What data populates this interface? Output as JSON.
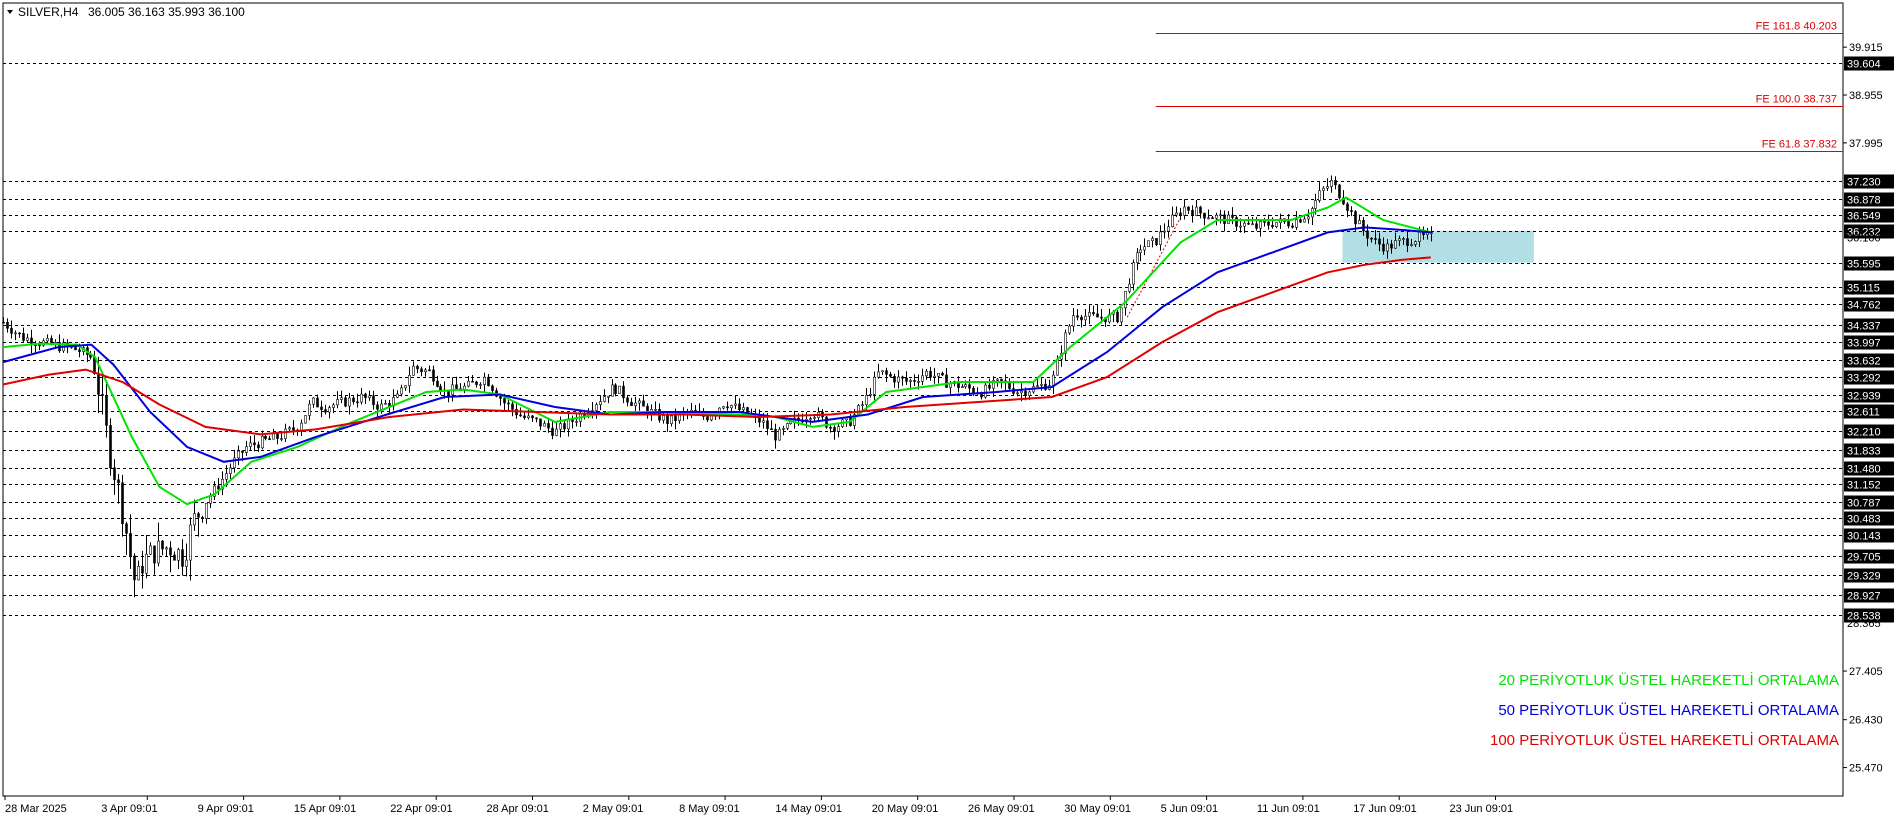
{
  "header": {
    "symbol": "SILVER,H4",
    "ohlc": "36.005 36.163 35.993 36.100"
  },
  "chart_data": {
    "type": "candlestick",
    "y_axis": {
      "range": [
        24.9,
        40.8
      ],
      "ticks": [
        "39.915",
        "38.955",
        "37.995",
        "27.405",
        "26.430",
        "25.470"
      ]
    },
    "x_axis": {
      "ticks": [
        "28 Mar 2025",
        "3 Apr 09:01",
        "9 Apr 09:01",
        "15 Apr 09:01",
        "22 Apr 09:01",
        "28 Apr 09:01",
        "2 May 09:01",
        "8 May 09:01",
        "14 May 09:01",
        "20 May 09:01",
        "26 May 09:01",
        "30 May 09:01",
        "5 Jun 09:01",
        "11 Jun 09:01",
        "17 Jun 09:01",
        "23 Jun 09:01"
      ]
    },
    "levels": [
      "39.604",
      "37.230",
      "36.878",
      "36.549",
      "36.232",
      "35.595",
      "35.115",
      "34.762",
      "34.337",
      "33.997",
      "33.632",
      "33.292",
      "32.939",
      "32.611",
      "32.210",
      "31.833",
      "31.480",
      "31.152",
      "30.787",
      "30.483",
      "30.143",
      "29.705",
      "29.329",
      "28.927",
      "28.538"
    ],
    "hidden_labels": [
      "36.100",
      "28.365"
    ],
    "fibonacci": [
      {
        "label": "FE 161.8 40.203",
        "value": 40.203
      },
      {
        "label": "FE 100.0 38.737",
        "value": 38.737
      },
      {
        "label": "FE 61.8 37.832",
        "value": 37.832
      }
    ],
    "zone": {
      "top": 36.232,
      "bottom": 35.595,
      "from_x": 0.728,
      "to_x": 0.832
    },
    "price_path": [
      [
        0.0,
        34.4
      ],
      [
        0.01,
        34.1
      ],
      [
        0.02,
        34.0
      ],
      [
        0.03,
        33.92
      ],
      [
        0.04,
        33.85
      ],
      [
        0.048,
        33.7
      ],
      [
        0.053,
        32.9
      ],
      [
        0.058,
        31.8
      ],
      [
        0.063,
        31.0
      ],
      [
        0.068,
        30.0
      ],
      [
        0.072,
        29.1
      ],
      [
        0.076,
        29.6
      ],
      [
        0.082,
        29.8
      ],
      [
        0.09,
        29.9
      ],
      [
        0.098,
        29.7
      ],
      [
        0.103,
        30.4
      ],
      [
        0.11,
        30.8
      ],
      [
        0.118,
        31.2
      ],
      [
        0.125,
        31.6
      ],
      [
        0.132,
        31.9
      ],
      [
        0.14,
        32.0
      ],
      [
        0.15,
        32.1
      ],
      [
        0.16,
        32.3
      ],
      [
        0.168,
        32.8
      ],
      [
        0.175,
        32.7
      ],
      [
        0.185,
        32.8
      ],
      [
        0.195,
        32.9
      ],
      [
        0.205,
        32.7
      ],
      [
        0.215,
        32.9
      ],
      [
        0.222,
        33.5
      ],
      [
        0.232,
        33.4
      ],
      [
        0.24,
        33.0
      ],
      [
        0.252,
        33.1
      ],
      [
        0.262,
        33.3
      ],
      [
        0.272,
        32.8
      ],
      [
        0.282,
        32.5
      ],
      [
        0.29,
        32.4
      ],
      [
        0.3,
        32.2
      ],
      [
        0.312,
        32.5
      ],
      [
        0.322,
        32.8
      ],
      [
        0.332,
        33.1
      ],
      [
        0.342,
        32.8
      ],
      [
        0.352,
        32.6
      ],
      [
        0.362,
        32.4
      ],
      [
        0.372,
        32.6
      ],
      [
        0.382,
        32.5
      ],
      [
        0.392,
        32.8
      ],
      [
        0.402,
        32.6
      ],
      [
        0.412,
        32.4
      ],
      [
        0.42,
        32.1
      ],
      [
        0.43,
        32.4
      ],
      [
        0.44,
        32.6
      ],
      [
        0.45,
        32.3
      ],
      [
        0.46,
        32.4
      ],
      [
        0.468,
        32.8
      ],
      [
        0.476,
        33.4
      ],
      [
        0.482,
        33.3
      ],
      [
        0.492,
        33.2
      ],
      [
        0.502,
        33.4
      ],
      [
        0.512,
        33.2
      ],
      [
        0.522,
        33.1
      ],
      [
        0.532,
        33.0
      ],
      [
        0.542,
        33.2
      ],
      [
        0.552,
        33.0
      ],
      [
        0.562,
        33.1
      ],
      [
        0.57,
        33.2
      ],
      [
        0.576,
        34.0
      ],
      [
        0.582,
        34.6
      ],
      [
        0.59,
        34.5
      ],
      [
        0.598,
        34.5
      ],
      [
        0.606,
        34.5
      ],
      [
        0.612,
        35.3
      ],
      [
        0.618,
        35.9
      ],
      [
        0.626,
        36.0
      ],
      [
        0.634,
        36.4
      ],
      [
        0.642,
        36.7
      ],
      [
        0.65,
        36.6
      ],
      [
        0.66,
        36.5
      ],
      [
        0.67,
        36.4
      ],
      [
        0.68,
        36.3
      ],
      [
        0.69,
        36.4
      ],
      [
        0.7,
        36.4
      ],
      [
        0.71,
        36.6
      ],
      [
        0.716,
        37.0
      ],
      [
        0.722,
        37.2
      ],
      [
        0.728,
        36.9
      ],
      [
        0.734,
        36.5
      ],
      [
        0.74,
        36.2
      ],
      [
        0.746,
        36.0
      ],
      [
        0.752,
        35.9
      ],
      [
        0.758,
        36.0
      ],
      [
        0.764,
        36.05
      ],
      [
        0.77,
        36.1
      ],
      [
        0.776,
        36.1
      ]
    ],
    "series": [
      {
        "name": "20 PERİYOTLUK ÜSTEL HAREKETLİ ORTALAMA",
        "color": "#00e400",
        "points": [
          [
            0.0,
            33.9
          ],
          [
            0.02,
            33.97
          ],
          [
            0.04,
            33.95
          ],
          [
            0.05,
            33.7
          ],
          [
            0.07,
            32.1
          ],
          [
            0.085,
            31.1
          ],
          [
            0.1,
            30.75
          ],
          [
            0.115,
            30.95
          ],
          [
            0.135,
            31.6
          ],
          [
            0.16,
            31.9
          ],
          [
            0.19,
            32.4
          ],
          [
            0.23,
            33.0
          ],
          [
            0.25,
            33.05
          ],
          [
            0.27,
            32.95
          ],
          [
            0.3,
            32.4
          ],
          [
            0.33,
            32.6
          ],
          [
            0.36,
            32.6
          ],
          [
            0.4,
            32.55
          ],
          [
            0.42,
            32.5
          ],
          [
            0.44,
            32.3
          ],
          [
            0.46,
            32.4
          ],
          [
            0.48,
            33.0
          ],
          [
            0.52,
            33.2
          ],
          [
            0.56,
            33.2
          ],
          [
            0.58,
            33.9
          ],
          [
            0.61,
            34.8
          ],
          [
            0.64,
            36.0
          ],
          [
            0.66,
            36.45
          ],
          [
            0.7,
            36.45
          ],
          [
            0.72,
            36.7
          ],
          [
            0.73,
            36.9
          ],
          [
            0.75,
            36.45
          ],
          [
            0.776,
            36.2
          ]
        ]
      },
      {
        "name": "50 PERİYOTLUK ÜSTEL HAREKETLİ ORTALAMA",
        "color": "#0000dd",
        "points": [
          [
            0.0,
            33.6
          ],
          [
            0.03,
            33.9
          ],
          [
            0.048,
            33.95
          ],
          [
            0.06,
            33.55
          ],
          [
            0.08,
            32.6
          ],
          [
            0.1,
            31.9
          ],
          [
            0.12,
            31.6
          ],
          [
            0.14,
            31.7
          ],
          [
            0.17,
            32.1
          ],
          [
            0.2,
            32.45
          ],
          [
            0.24,
            32.9
          ],
          [
            0.27,
            32.95
          ],
          [
            0.3,
            32.7
          ],
          [
            0.33,
            32.55
          ],
          [
            0.36,
            32.6
          ],
          [
            0.4,
            32.6
          ],
          [
            0.44,
            32.4
          ],
          [
            0.47,
            32.55
          ],
          [
            0.5,
            32.9
          ],
          [
            0.54,
            33.0
          ],
          [
            0.57,
            33.1
          ],
          [
            0.6,
            33.8
          ],
          [
            0.63,
            34.7
          ],
          [
            0.66,
            35.4
          ],
          [
            0.69,
            35.8
          ],
          [
            0.72,
            36.2
          ],
          [
            0.74,
            36.3
          ],
          [
            0.76,
            36.25
          ],
          [
            0.776,
            36.2
          ]
        ]
      },
      {
        "name": "100 PERİYOTLUK ÜSTEL HAREKETLİ ORTALAMA",
        "color": "#e00000",
        "points": [
          [
            0.0,
            33.15
          ],
          [
            0.025,
            33.35
          ],
          [
            0.045,
            33.45
          ],
          [
            0.065,
            33.2
          ],
          [
            0.085,
            32.75
          ],
          [
            0.11,
            32.3
          ],
          [
            0.14,
            32.15
          ],
          [
            0.17,
            32.25
          ],
          [
            0.21,
            32.5
          ],
          [
            0.25,
            32.65
          ],
          [
            0.29,
            32.6
          ],
          [
            0.33,
            32.55
          ],
          [
            0.37,
            32.55
          ],
          [
            0.41,
            32.5
          ],
          [
            0.45,
            32.55
          ],
          [
            0.49,
            32.7
          ],
          [
            0.53,
            32.8
          ],
          [
            0.57,
            32.9
          ],
          [
            0.6,
            33.3
          ],
          [
            0.63,
            34.0
          ],
          [
            0.66,
            34.6
          ],
          [
            0.69,
            35.0
          ],
          [
            0.72,
            35.4
          ],
          [
            0.74,
            35.55
          ],
          [
            0.76,
            35.65
          ],
          [
            0.776,
            35.7
          ]
        ]
      }
    ],
    "legend": [
      {
        "text": "20 PERİYOTLUK ÜSTEL HAREKETLİ ORTALAMA",
        "color": "#00e400"
      },
      {
        "text": "50 PERİYOTLUK ÜSTEL HAREKETLİ ORTALAMA",
        "color": "#0000dd"
      },
      {
        "text": "100 PERİYOTLUK ÜSTEL HAREKETLİ ORTALAMA",
        "color": "#e00000"
      }
    ],
    "colors": {
      "level": "#000000",
      "fib": "#e00000",
      "zone": "#a8dce2",
      "candle": "#000000",
      "background": "#ffffff"
    }
  }
}
